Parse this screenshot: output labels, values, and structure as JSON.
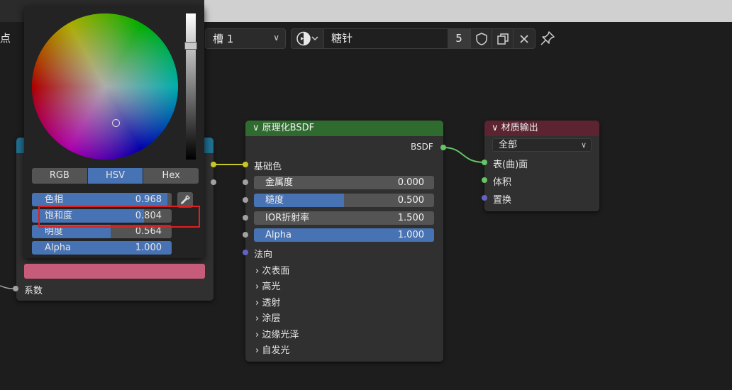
{
  "header": {
    "left_text": "点",
    "slot_label": "槽 1",
    "material_name": "糖针",
    "users_count": "5"
  },
  "principled_node": {
    "title": "原理化BSDF",
    "output_label": "BSDF",
    "base_color_label": "基础色",
    "fields": [
      {
        "label": "金属度",
        "value": "0.000",
        "fraction": 0.0
      },
      {
        "label": "糙度",
        "value": "0.500",
        "fraction": 0.5
      },
      {
        "label": "IOR折射率",
        "value": "1.500",
        "fraction": 0.0
      },
      {
        "label": "Alpha",
        "value": "1.000",
        "fraction": 1.0
      }
    ],
    "normal_label": "法向",
    "panels": [
      "次表面",
      "高光",
      "透射",
      "涂层",
      "边缘光泽",
      "自发光"
    ]
  },
  "output_node": {
    "title": "材质输出",
    "target": "全部",
    "sockets": [
      "表(曲)面",
      "体积",
      "置换"
    ]
  },
  "left_node": {
    "factor_label": "系数"
  },
  "color_picker": {
    "tabs": [
      "RGB",
      "HSV",
      "Hex"
    ],
    "active_tab": "HSV",
    "fields": [
      {
        "label": "色相",
        "value": "0.968",
        "fraction": 0.968
      },
      {
        "label": "饱和度",
        "value": "0.804",
        "fraction": 0.804
      },
      {
        "label": "明度",
        "value": "0.564",
        "fraction": 0.564
      },
      {
        "label": "Alpha",
        "value": "1.000",
        "fraction": 1.0
      }
    ],
    "swatch_color": "#c75c7a",
    "value_level": 0.564
  },
  "colors": {
    "principled_header": "#2f6b2f",
    "output_header": "#5c2331",
    "left_header": "#1f6f8f",
    "accent": "#4772b3",
    "highlight": "#e02020"
  }
}
